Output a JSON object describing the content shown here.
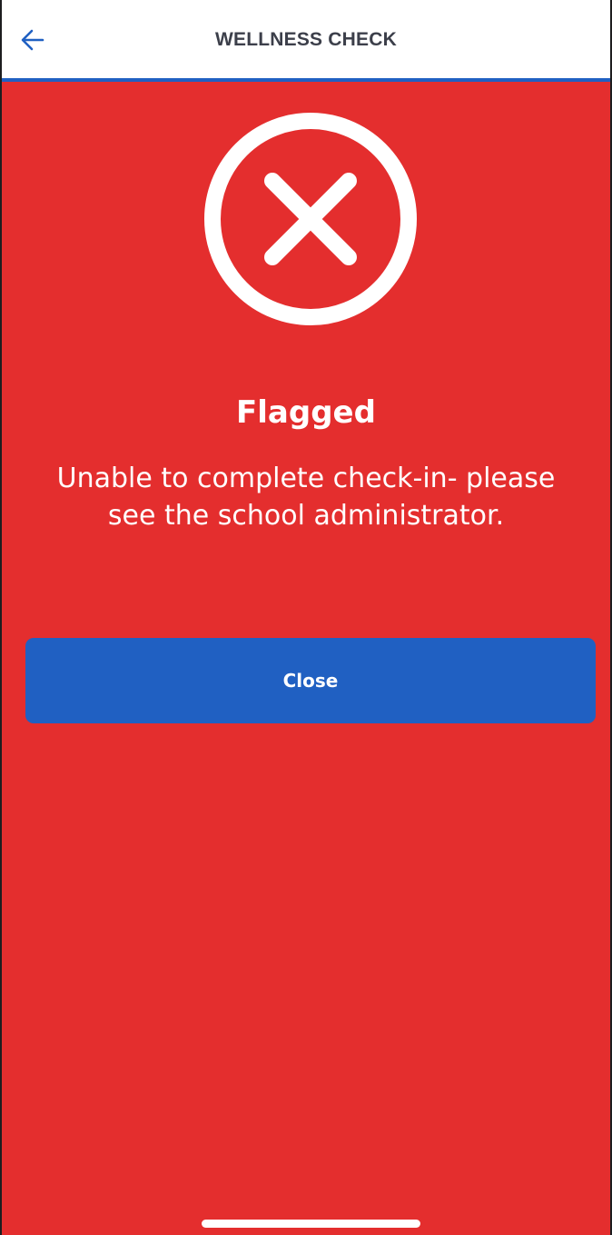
{
  "header": {
    "title": "WELLNESS CHECK",
    "back_icon": "arrow-left-icon"
  },
  "status": {
    "icon": "x-circle-icon",
    "title": "Flagged",
    "message": "Unable to complete check-in- please see the school administrator."
  },
  "actions": {
    "close_label": "Close"
  },
  "colors": {
    "alert_red": "#e42e2e",
    "accent_blue": "#2060c2",
    "header_text": "#3c3f4a",
    "white": "#ffffff"
  }
}
